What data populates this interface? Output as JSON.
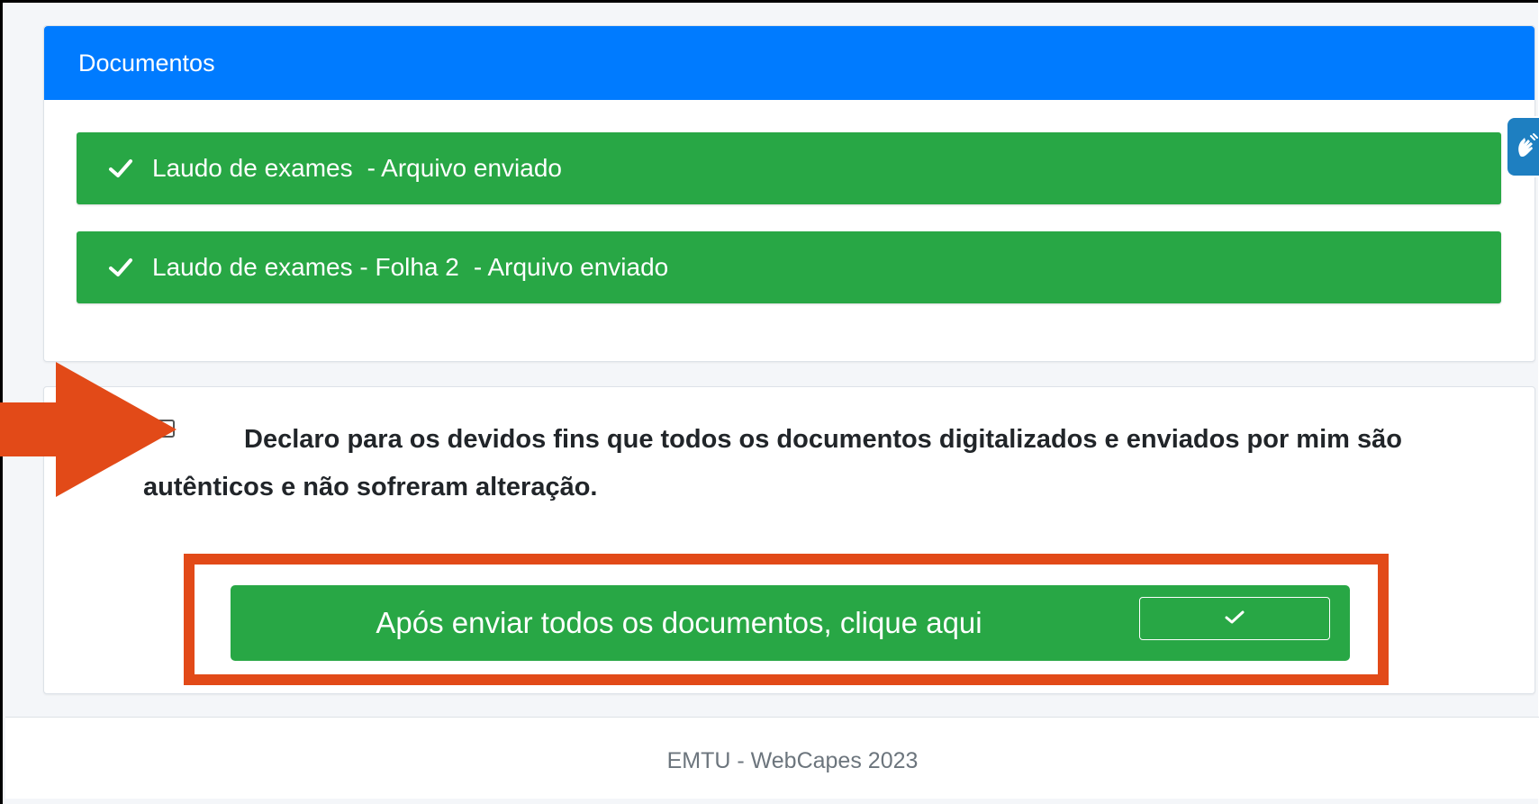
{
  "documents_card": {
    "title": "Documentos",
    "items": [
      {
        "name": "Laudo de exames",
        "status": "- Arquivo enviado"
      },
      {
        "name": "Laudo de exames - Folha 2",
        "status": "- Arquivo enviado"
      }
    ]
  },
  "declaration": {
    "text": "Declaro para os devidos fins que todos os documentos digitalizados e enviados por mim são autênticos e não sofreram alteração.",
    "checked": false
  },
  "submit_button": {
    "label": "Após enviar todos os documentos, clique aqui"
  },
  "footer": {
    "text": "EMTU - WebCapes 2023"
  },
  "colors": {
    "header_blue": "#007bff",
    "success_green": "#28a745",
    "annotation_orange": "#e24a18",
    "accessibility_blue": "#1e7fc1"
  },
  "icons": {
    "document_status": "check-icon",
    "submit": "check-icon",
    "annotation": "arrow-right-icon",
    "accessibility": "sign-language-hands-icon"
  }
}
